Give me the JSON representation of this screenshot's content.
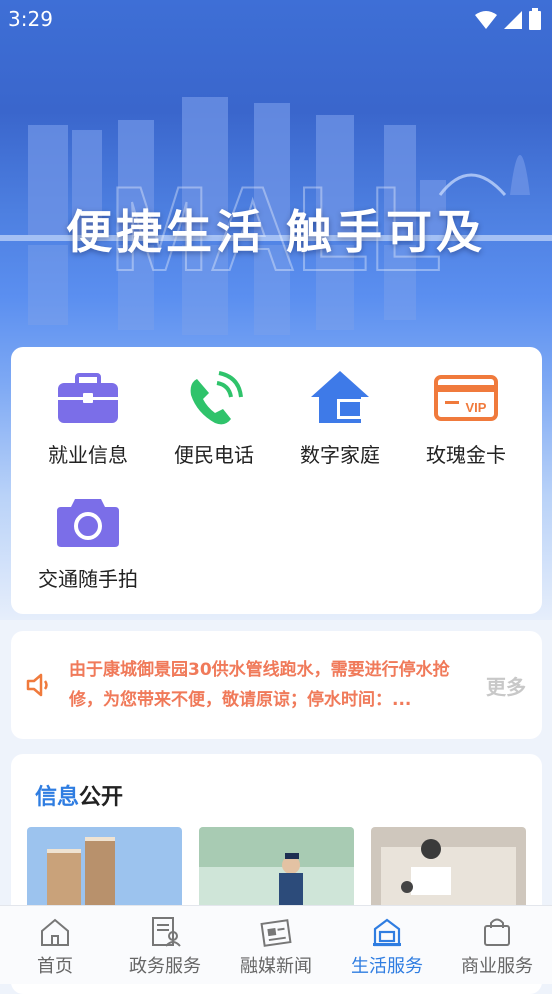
{
  "status_bar": {
    "time": "3:29"
  },
  "hero": {
    "title": "便捷生活 触手可及",
    "watermark": "MALL"
  },
  "services": [
    {
      "label": "就业信息",
      "icon": "briefcase-icon",
      "color": "#7b6ee8"
    },
    {
      "label": "便民电话",
      "icon": "phone-icon",
      "color": "#2fc36b"
    },
    {
      "label": "数字家庭",
      "icon": "home-icon",
      "color": "#3e7ae8"
    },
    {
      "label": "玫瑰金卡",
      "icon": "vip-card-icon",
      "color": "#f07a3c"
    },
    {
      "label": "交通随手拍",
      "icon": "camera-icon",
      "color": "#7b6ee8"
    }
  ],
  "notice": {
    "text": "由于康城御景园30供水管线跑水，需要进行停水抢修，为您带来不便，敬请原谅；停水时间：...",
    "more_label": "更多"
  },
  "info": {
    "title_highlight": "信息",
    "title_rest": "公开"
  },
  "tabs": [
    {
      "label": "首页",
      "icon": "home-outline-icon",
      "active": false
    },
    {
      "label": "政务服务",
      "icon": "document-user-icon",
      "active": false
    },
    {
      "label": "融媒新闻",
      "icon": "newspaper-icon",
      "active": false
    },
    {
      "label": "生活服务",
      "icon": "life-service-icon",
      "active": true
    },
    {
      "label": "商业服务",
      "icon": "shopping-bag-icon",
      "active": false
    }
  ],
  "colors": {
    "accent": "#2f7de1",
    "notice_text": "#f07a5a",
    "more_text": "#c8c8c8"
  }
}
